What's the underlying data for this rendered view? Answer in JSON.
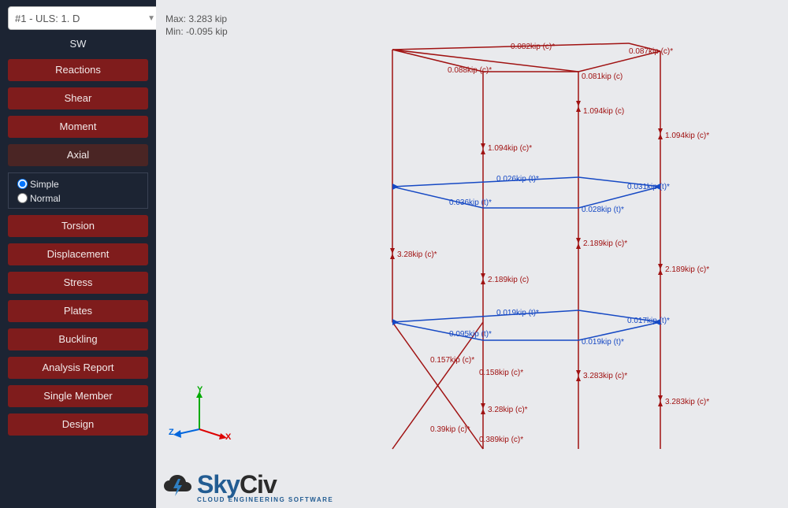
{
  "dropdown": {
    "selected": "#1 - ULS: 1. D"
  },
  "sw_label": "SW",
  "buttons": {
    "reactions": "Reactions",
    "shear": "Shear",
    "moment": "Moment",
    "axial": "Axial",
    "torsion": "Torsion",
    "displacement": "Displacement",
    "stress": "Stress",
    "plates": "Plates",
    "buckling": "Buckling",
    "analysis_report": "Analysis Report",
    "single_member": "Single Member",
    "design": "Design"
  },
  "radio": {
    "simple": "Simple",
    "normal": "Normal"
  },
  "stats": {
    "max": "Max: 3.283 kip",
    "min": "Min: -0.095 kip"
  },
  "axis": {
    "x": "X",
    "y": "Y",
    "z": "Z"
  },
  "logo": {
    "brand1": "Sky",
    "brand2": "Civ",
    "tagline": "CLOUD ENGINEERING SOFTWARE"
  },
  "labels": {
    "l1": {
      "text": "0.082kip (c)*",
      "color": "red"
    },
    "l2": {
      "text": "0.087kip (c)*",
      "color": "red"
    },
    "l3": {
      "text": "0.088kip (c)*",
      "color": "red"
    },
    "l4": {
      "text": "0.081kip (c)",
      "color": "red"
    },
    "l5": {
      "text": "1.094kip (c)",
      "color": "red"
    },
    "l6": {
      "text": "1.094kip (c)*",
      "color": "red"
    },
    "l7": {
      "text": "1.094kip (c)*",
      "color": "red"
    },
    "l8": {
      "text": "0.026kip (t)*",
      "color": "blue"
    },
    "l9": {
      "text": "0.031kip (t)*",
      "color": "blue"
    },
    "l10": {
      "text": "0.036kip (t)*",
      "color": "blue"
    },
    "l11": {
      "text": "0.028kip (t)*",
      "color": "blue"
    },
    "l12": {
      "text": "3.28kip (c)*",
      "color": "red"
    },
    "l13": {
      "text": "2.189kip (c)*",
      "color": "red"
    },
    "l14": {
      "text": "2.189kip (c)",
      "color": "red"
    },
    "l15": {
      "text": "2.189kip (c)*",
      "color": "red"
    },
    "l16": {
      "text": "0.019kip (t)*",
      "color": "blue"
    },
    "l17": {
      "text": "0.017kip (t)*",
      "color": "blue"
    },
    "l18": {
      "text": "0.095kip (t)*",
      "color": "blue"
    },
    "l19": {
      "text": "0.019kip (t)*",
      "color": "blue"
    },
    "l20": {
      "text": "0.157kip (c)*",
      "color": "red"
    },
    "l21": {
      "text": "0.158kip (c)*",
      "color": "red"
    },
    "l22": {
      "text": "3.283kip (c)*",
      "color": "red"
    },
    "l23": {
      "text": "3.283kip (c)*",
      "color": "red"
    },
    "l24": {
      "text": "3.28kip (c)*",
      "color": "red"
    },
    "l25": {
      "text": "0.39kip (c)*",
      "color": "red"
    },
    "l26": {
      "text": "0.389kip (c)*",
      "color": "red"
    }
  }
}
